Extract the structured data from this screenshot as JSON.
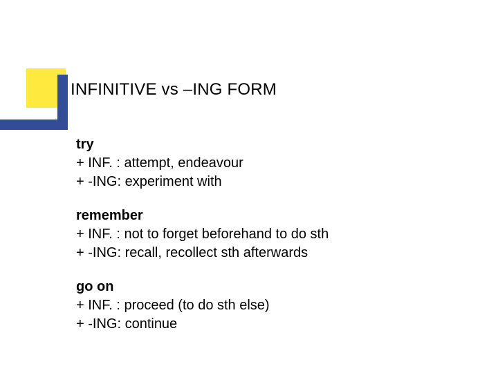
{
  "title": "INFINITIVE vs –ING FORM",
  "groups": [
    {
      "word": "try",
      "inf": "+ INF. : attempt, endeavour",
      "ing": "+ -ING: experiment with"
    },
    {
      "word": "remember",
      "inf": "+ INF. : not to forget beforehand to do sth",
      "ing": "+ -ING: recall, recollect sth afterwards"
    },
    {
      "word": "go on",
      "inf": "+ INF. : proceed (to do sth else)",
      "ing": "+ -ING: continue"
    }
  ]
}
